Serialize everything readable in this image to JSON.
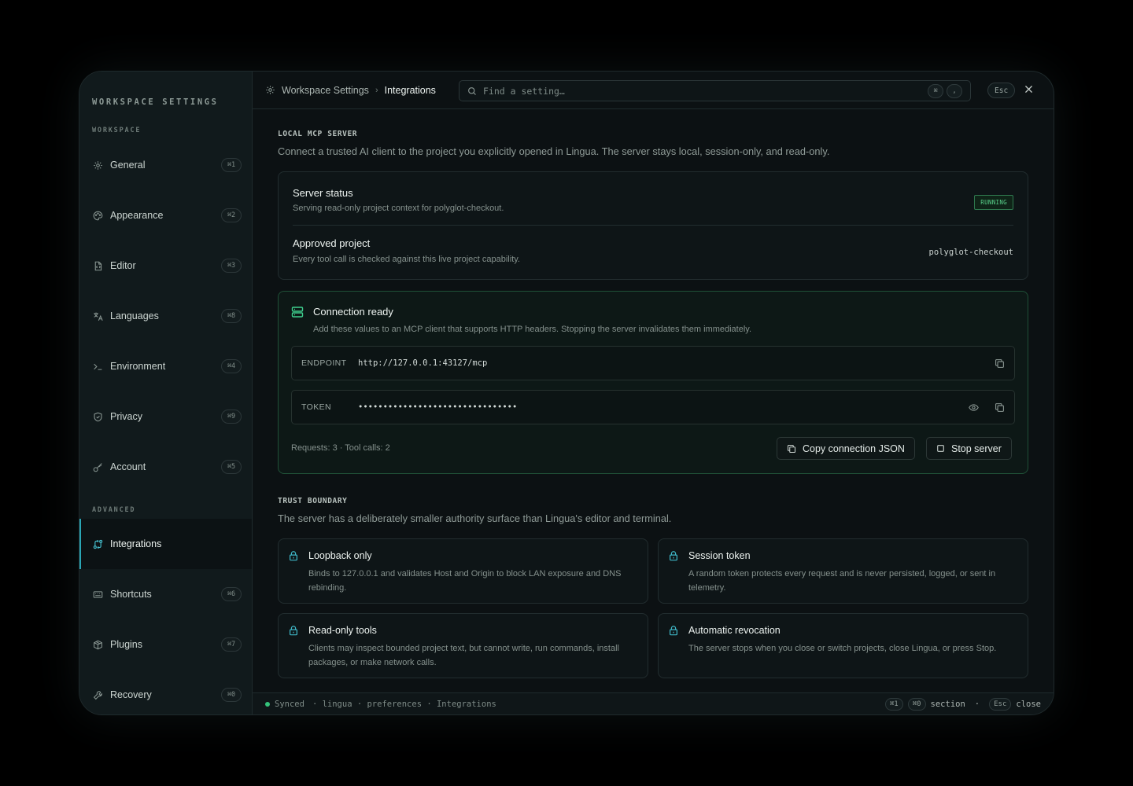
{
  "sidebar": {
    "title": "WORKSPACE SETTINGS",
    "group_workspace": "WORKSPACE",
    "group_advanced": "ADVANCED",
    "items": [
      {
        "label": "General",
        "shortcut": "⌘1",
        "icon": "gear-icon"
      },
      {
        "label": "Appearance",
        "shortcut": "⌘2",
        "icon": "palette-icon"
      },
      {
        "label": "Editor",
        "shortcut": "⌘3",
        "icon": "file-code-icon"
      },
      {
        "label": "Languages",
        "shortcut": "⌘8",
        "icon": "translate-icon"
      },
      {
        "label": "Environment",
        "shortcut": "⌘4",
        "icon": "terminal-icon"
      },
      {
        "label": "Privacy",
        "shortcut": "⌘9",
        "icon": "shield-icon"
      },
      {
        "label": "Account",
        "shortcut": "⌘5",
        "icon": "key-icon"
      },
      {
        "label": "Integrations",
        "shortcut": "",
        "icon": "integrations-icon",
        "active": true
      },
      {
        "label": "Shortcuts",
        "shortcut": "⌘6",
        "icon": "keyboard-icon"
      },
      {
        "label": "Plugins",
        "shortcut": "⌘7",
        "icon": "package-icon"
      },
      {
        "label": "Recovery",
        "shortcut": "⌘0",
        "icon": "wrench-icon"
      }
    ]
  },
  "topbar": {
    "breadcrumb_root": "Workspace Settings",
    "breadcrumb_current": "Integrations",
    "search_placeholder": "Find a setting…",
    "search_kbd_1": "⌘",
    "search_kbd_2": ",",
    "esc_label": "Esc"
  },
  "mcp": {
    "heading": "LOCAL MCP SERVER",
    "description": "Connect a trusted AI client to the project you explicitly opened in Lingua. The server stays local, session-only, and read-only.",
    "status_title": "Server status",
    "status_sub": "Serving read-only project context for polyglot-checkout.",
    "status_badge": "RUNNING",
    "project_title": "Approved project",
    "project_sub": "Every tool call is checked against this live project capability.",
    "project_value": "polyglot-checkout"
  },
  "connection": {
    "title": "Connection ready",
    "description": "Add these values to an MCP client that supports HTTP headers. Stopping the server invalidates them immediately.",
    "endpoint_label": "ENDPOINT",
    "endpoint_value": "http://127.0.0.1:43127/mcp",
    "token_label": "TOKEN",
    "token_value": "••••••••••••••••••••••••••••••••",
    "stats": "Requests: 3 · Tool calls: 2",
    "copy_json_label": "Copy connection JSON",
    "stop_label": "Stop server"
  },
  "trust": {
    "heading": "TRUST BOUNDARY",
    "description": "The server has a deliberately smaller authority surface than Lingua's editor and terminal.",
    "tiles": [
      {
        "title": "Loopback only",
        "desc": "Binds to 127.0.0.1 and validates Host and Origin to block LAN exposure and DNS rebinding."
      },
      {
        "title": "Session token",
        "desc": "A random token protects every request and is never persisted, logged, or sent in telemetry."
      },
      {
        "title": "Read-only tools",
        "desc": "Clients may inspect bounded project text, but cannot write, run commands, install packages, or make network calls."
      },
      {
        "title": "Automatic revocation",
        "desc": "The server stops when you close or switch projects, close Lingua, or press Stop."
      }
    ]
  },
  "statusbar": {
    "synced": "Synced",
    "path": "·  lingua · preferences · Integrations",
    "kbd_1": "⌘1",
    "kbd_2": "⌘0",
    "section_label": "section",
    "dot_sep": "·",
    "esc": "Esc",
    "close_label": "close"
  },
  "colors": {
    "accent": "#2aa6b5",
    "running": "#5ad38c",
    "ready_border": "#1f5037"
  }
}
